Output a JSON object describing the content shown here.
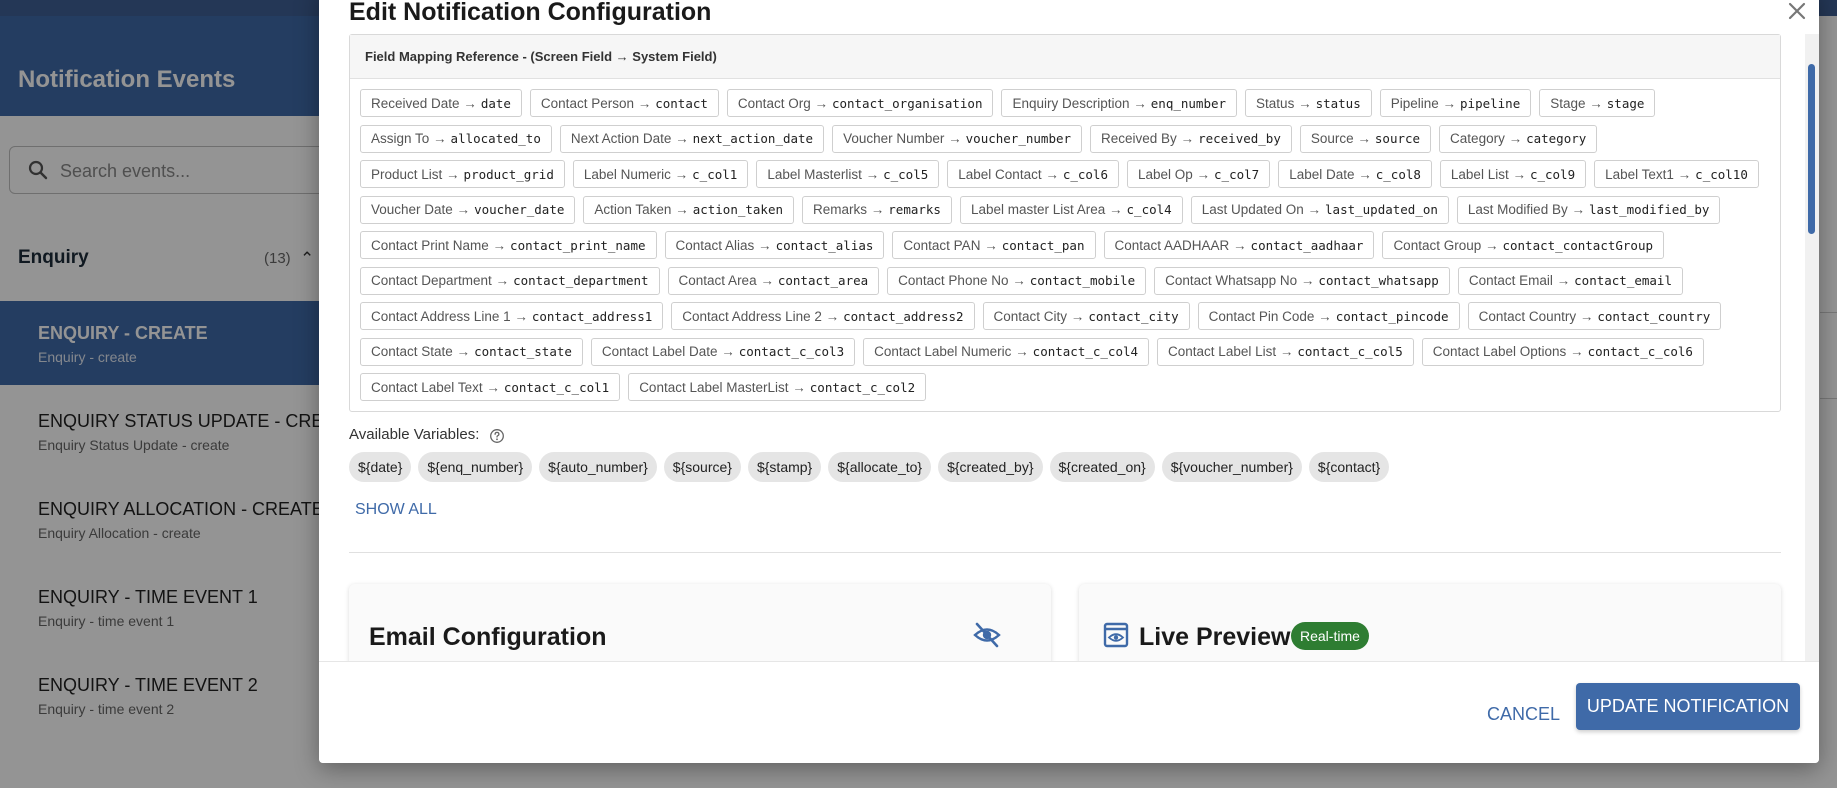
{
  "background": {
    "header_title": "Notification Events",
    "search_placeholder": "Search events...",
    "section_title": "Enquiry",
    "section_count": "(13)",
    "events": [
      {
        "title": "ENQUIRY - CREATE",
        "subtitle": "Enquiry - create",
        "active": true
      },
      {
        "title": "ENQUIRY STATUS UPDATE - CREATE",
        "subtitle": "Enquiry Status Update - create",
        "active": false
      },
      {
        "title": "ENQUIRY ALLOCATION - CREATE",
        "subtitle": "Enquiry Allocation - create",
        "active": false
      },
      {
        "title": "ENQUIRY - TIME EVENT 1",
        "subtitle": "Enquiry - time event 1",
        "active": false
      },
      {
        "title": "ENQUIRY - TIME EVENT 2",
        "subtitle": "Enquiry - time event 2",
        "active": false
      }
    ]
  },
  "modal": {
    "title": "Edit Notification Configuration",
    "mapping_title": "Field Mapping Reference - (Screen Field → System Field)",
    "mappings": [
      {
        "screen": "Received Date →",
        "system": "date"
      },
      {
        "screen": "Contact Person →",
        "system": "contact"
      },
      {
        "screen": "Contact Org →",
        "system": "contact_organisation"
      },
      {
        "screen": "Enquiry Description →",
        "system": "enq_number"
      },
      {
        "screen": "Status →",
        "system": "status"
      },
      {
        "screen": "Pipeline →",
        "system": "pipeline"
      },
      {
        "screen": "Stage →",
        "system": "stage"
      },
      {
        "screen": "Assign To →",
        "system": "allocated_to"
      },
      {
        "screen": "Next Action Date →",
        "system": "next_action_date"
      },
      {
        "screen": "Voucher Number →",
        "system": "voucher_number"
      },
      {
        "screen": "Received By →",
        "system": "received_by"
      },
      {
        "screen": "Source →",
        "system": "source"
      },
      {
        "screen": "Category →",
        "system": "category"
      },
      {
        "screen": "Product List →",
        "system": "product_grid"
      },
      {
        "screen": "Label Numeric →",
        "system": "c_col1"
      },
      {
        "screen": "Label Masterlist →",
        "system": "c_col5"
      },
      {
        "screen": "Label Contact →",
        "system": "c_col6"
      },
      {
        "screen": "Label Op →",
        "system": "c_col7"
      },
      {
        "screen": "Label Date →",
        "system": "c_col8"
      },
      {
        "screen": "Label List →",
        "system": "c_col9"
      },
      {
        "screen": "Label Text1 →",
        "system": "c_col10"
      },
      {
        "screen": "Voucher Date →",
        "system": "voucher_date"
      },
      {
        "screen": "Action Taken →",
        "system": "action_taken"
      },
      {
        "screen": "Remarks →",
        "system": "remarks"
      },
      {
        "screen": "Label master List Area →",
        "system": "c_col4"
      },
      {
        "screen": "Last Updated On →",
        "system": "last_updated_on"
      },
      {
        "screen": "Last Modified By →",
        "system": "last_modified_by"
      },
      {
        "screen": "Contact Print Name →",
        "system": "contact_print_name"
      },
      {
        "screen": "Contact Alias →",
        "system": "contact_alias"
      },
      {
        "screen": "Contact PAN →",
        "system": "contact_pan"
      },
      {
        "screen": "Contact AADHAAR →",
        "system": "contact_aadhaar"
      },
      {
        "screen": "Contact Group →",
        "system": "contact_contactGroup"
      },
      {
        "screen": "Contact Department →",
        "system": "contact_department"
      },
      {
        "screen": "Contact Area →",
        "system": "contact_area"
      },
      {
        "screen": "Contact Phone No →",
        "system": "contact_mobile"
      },
      {
        "screen": "Contact Whatsapp No →",
        "system": "contact_whatsapp"
      },
      {
        "screen": "Contact Email →",
        "system": "contact_email"
      },
      {
        "screen": "Contact Address Line 1 →",
        "system": "contact_address1"
      },
      {
        "screen": "Contact Address Line 2 →",
        "system": "contact_address2"
      },
      {
        "screen": "Contact City →",
        "system": "contact_city"
      },
      {
        "screen": "Contact Pin Code →",
        "system": "contact_pincode"
      },
      {
        "screen": "Contact Country →",
        "system": "contact_country"
      },
      {
        "screen": "Contact State →",
        "system": "contact_state"
      },
      {
        "screen": "Contact Label Date →",
        "system": "contact_c_col3"
      },
      {
        "screen": "Contact Label Numeric →",
        "system": "contact_c_col4"
      },
      {
        "screen": "Contact Label List →",
        "system": "contact_c_col5"
      },
      {
        "screen": "Contact Label Options →",
        "system": "contact_c_col6"
      },
      {
        "screen": "Contact Label Text →",
        "system": "contact_c_col1"
      },
      {
        "screen": "Contact Label MasterList →",
        "system": "contact_c_col2"
      }
    ],
    "variables_label": "Available Variables:",
    "variables": [
      "${date}",
      "${enq_number}",
      "${auto_number}",
      "${source}",
      "${stamp}",
      "${allocate_to}",
      "${created_by}",
      "${created_on}",
      "${voucher_number}",
      "${contact}"
    ],
    "show_all": "SHOW ALL",
    "email_card_title": "Email Configuration",
    "preview_card_title": "Live Preview",
    "preview_badge": "Real-time",
    "cancel_label": "CANCEL",
    "update_label": "UPDATE NOTIFICATION"
  },
  "colors": {
    "primary": "#3f6aa8",
    "badge_green": "#2e7d32"
  },
  "icons": [
    "search-icon",
    "chevron-up-icon",
    "close-icon",
    "help-circle-icon",
    "eye-off-icon",
    "preview-icon"
  ]
}
